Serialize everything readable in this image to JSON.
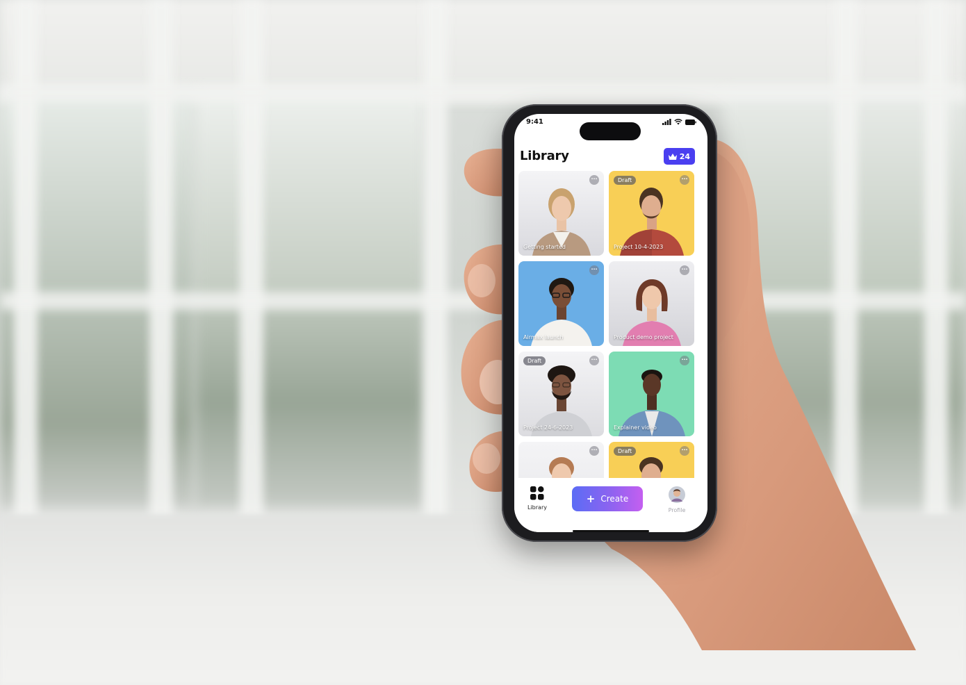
{
  "status_bar": {
    "time": "9:41"
  },
  "header": {
    "title": "Library",
    "credits": {
      "icon": "crown-icon",
      "count": "24"
    }
  },
  "cards": [
    {
      "label": "Getting started",
      "draft": false,
      "bg": "#e9e9ec"
    },
    {
      "label": "Project 10-4-2023",
      "draft": true,
      "draft_label": "Draft",
      "bg": "#f8cf56"
    },
    {
      "label": "Airmax launch",
      "draft": false,
      "bg": "#6aaee6"
    },
    {
      "label": "Product demo project",
      "draft": false,
      "bg": "#e3e3e7"
    },
    {
      "label": "Project 24-6-2023",
      "draft": true,
      "draft_label": "Draft",
      "bg": "#ececef"
    },
    {
      "label": "Explainer video",
      "draft": false,
      "bg": "#7ddcb4"
    },
    {
      "label": "",
      "draft": false,
      "bg": "#ededf0"
    },
    {
      "label": "",
      "draft": true,
      "draft_label": "Draft",
      "bg": "#f8cf56"
    }
  ],
  "tab_bar": {
    "library": {
      "label": "Library",
      "icon": "grid-icon"
    },
    "create": {
      "label": "Create",
      "icon": "plus-icon"
    },
    "profile": {
      "label": "Profile",
      "icon": "avatar"
    }
  },
  "colors": {
    "accent": "#4a3ff0",
    "create_gradient_start": "#5b6cf5",
    "create_gradient_end": "#c45ff0"
  }
}
